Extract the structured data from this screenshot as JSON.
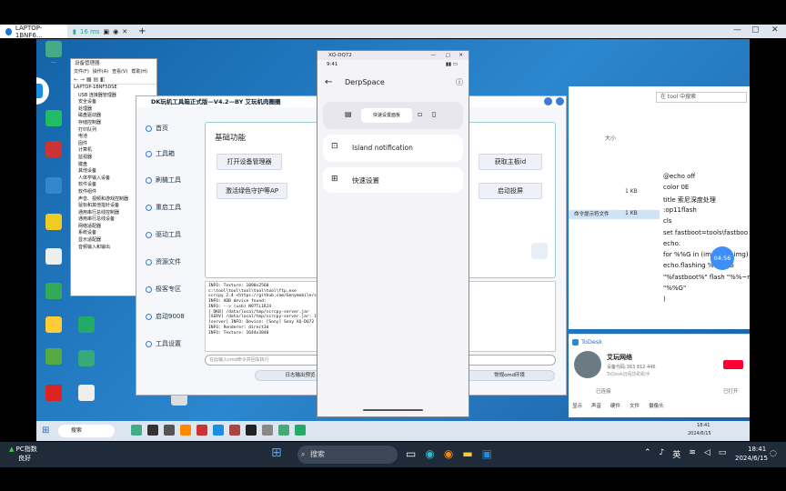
{
  "browser": {
    "tab_title": "LAPTOP-1BNF6...",
    "ping": "16 ms",
    "new_tab": "+"
  },
  "remote_desktop": {
    "devmgr": {
      "title": "设备管理器",
      "menu": [
        "文件(F)",
        "操作(A)",
        "查看(V)",
        "帮助(H)"
      ],
      "root": "LAPTOP-1BNF5DSE",
      "items": [
        "USB 连接器管理器",
        "安全设备",
        "处理器",
        "磁盘驱动器",
        "存储控制器",
        "打印队列",
        "电池",
        "固件",
        "计算机",
        "监视器",
        "键盘",
        "其他设备",
        "人体学输入设备",
        "软件设备",
        "软件组件",
        "声音、视频和游戏控制器",
        "鼠标和其他指针设备",
        "通用串行总线控制器",
        "通用串行总线设备",
        "网络适配器",
        "系统设备",
        "显示适配器",
        "音频输入和输出"
      ]
    },
    "flash_tool": {
      "title": "DK玩机工具箱正式版—V4.2—BY 艾玩机肉圈圈",
      "sidebar": [
        "首页",
        "工具箱",
        "刷機工具",
        "重启工具",
        "驱动工具",
        "资源文件",
        "极客专区",
        "启动9008",
        "工具设置"
      ],
      "section_title": "基础功能",
      "buttons": [
        "打开设备管理器",
        "获取主板id",
        "激活绿色守护等AP",
        "启动投屏"
      ],
      "log_lines": [
        "INFO: Texture: 1090x2560",
        "c:\\tool\\tool\\tool\\tool\\tool\\ftp.exe",
        "scrcpy 2.4 <https://github.com/Genymobile/scrcpy>",
        "INFO: ADB device found:",
        "INFO:    -->   (usb)  N97TL1RJ4",
        "[ DKB] /data/local/tmp/scrcpy-server.jar",
        "[SERV] /data/local/tmp/scrcpy-server.jar: 1 file pushed",
        "[server] INFO: Device: [Sony] Sony XQ-DQ72",
        "INFO: Renderer: direct3d",
        "INFO: Texture: 1644x3840"
      ],
      "cmd_placeholder": "在此输入cmd命令并回车执行",
      "bottom_buttons": [
        "日志输出预览",
        "常规cmd环境"
      ]
    },
    "phone": {
      "window_title": "XQ-DQ72",
      "time": "9:41",
      "app_title": "DerpSpace",
      "top_card_text": "快速设置面板",
      "items": [
        "Island notification",
        "快速设置"
      ]
    },
    "notepad": {
      "search_hint": "在 tool 中搜索",
      "list_label": "大小",
      "sizes": [
        "1 KB",
        "1 KB"
      ],
      "selected": "命令提示符文件",
      "code": [
        "@echo off",
        "color 0E",
        "title 索尼深度处理",
        ":op11flash",
        "cls",
        "set fastboot=tools\\fastboo",
        "echo.",
        "for %%G in (images\\*.img) c",
        "echo.flashing %%~nG",
        "\"%fastboot%\" flash \"%%~r",
        "\"%%G\"",
        ")"
      ],
      "timer": "04:56"
    },
    "todesk": {
      "app_name": "ToDesk",
      "user": "艾玩网络",
      "id": "设备代码:363 812 446",
      "desc": "ToDesk远程协助助手",
      "tag": "已连接",
      "options": [
        "显示",
        "声音",
        "硬件",
        "文件",
        "摄像头"
      ],
      "status": "已打开"
    },
    "taskbar": {
      "search": "搜索",
      "time": "18:41",
      "date": "2024/6/15"
    }
  },
  "host": {
    "weather": "PC指数",
    "weather_sub": "良好",
    "search": "搜索",
    "lang": "英",
    "time": "18:41",
    "date": "2024/6/15"
  }
}
